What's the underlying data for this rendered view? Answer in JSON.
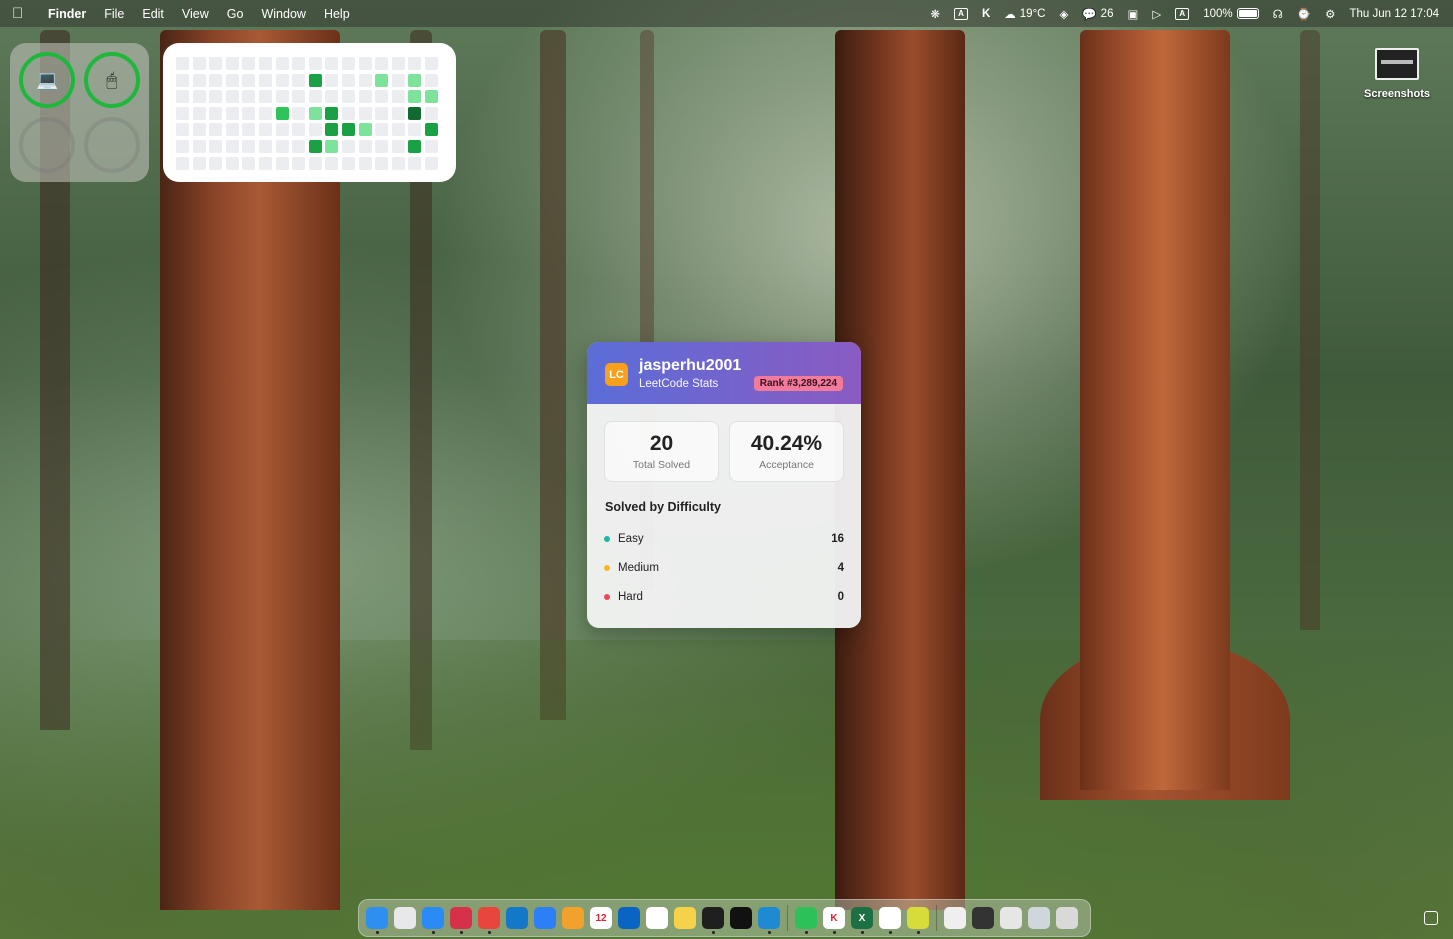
{
  "menubar": {
    "apple_icon": "apple-icon",
    "app_name": "Finder",
    "menus": [
      "File",
      "Edit",
      "View",
      "Go",
      "Window",
      "Help"
    ],
    "status": {
      "weather": "19°C",
      "wechat_count": "26",
      "input_source": "A",
      "battery": "100%",
      "datetime": "Thu Jun 12  17:04"
    }
  },
  "rings_widget": {
    "devices": [
      {
        "icon": "laptop-icon",
        "glyph": "💻",
        "active": true
      },
      {
        "icon": "mouse-icon",
        "glyph": "🖱",
        "active": true
      },
      {
        "icon": "empty-slot",
        "glyph": "",
        "active": false
      },
      {
        "icon": "empty-slot",
        "glyph": "",
        "active": false
      }
    ]
  },
  "heatmap": {
    "columns": 16,
    "rows": 7,
    "levels": [
      [
        0,
        0,
        0,
        0,
        0,
        0,
        0,
        0,
        0,
        0,
        0,
        0,
        0,
        0,
        0,
        0
      ],
      [
        0,
        0,
        0,
        0,
        0,
        0,
        0,
        0,
        3,
        0,
        0,
        0,
        1,
        0,
        1,
        0
      ],
      [
        0,
        0,
        0,
        0,
        0,
        0,
        0,
        0,
        0,
        0,
        0,
        0,
        0,
        0,
        1,
        1
      ],
      [
        0,
        0,
        0,
        0,
        0,
        0,
        2,
        0,
        1,
        3,
        0,
        0,
        0,
        0,
        4,
        0
      ],
      [
        0,
        0,
        0,
        0,
        0,
        0,
        0,
        0,
        0,
        3,
        3,
        1,
        0,
        0,
        0,
        3
      ],
      [
        0,
        0,
        0,
        0,
        0,
        0,
        0,
        0,
        3,
        1,
        0,
        0,
        0,
        0,
        3,
        0
      ],
      [
        0,
        0,
        0,
        0,
        0,
        0,
        0,
        0,
        0,
        0,
        0,
        0,
        0,
        0,
        0,
        0
      ]
    ]
  },
  "desktop": {
    "folder_label": "Screenshots"
  },
  "leetcode": {
    "logo": "LC",
    "username": "jasperhu2001",
    "subtitle": "LeetCode Stats",
    "rank": "Rank #3,289,224",
    "total_solved": "20",
    "total_solved_label": "Total Solved",
    "acceptance": "40.24%",
    "acceptance_label": "Acceptance",
    "section_title": "Solved by Difficulty",
    "difficulties": [
      {
        "label": "Easy",
        "count": "16",
        "color": "#1cb8a6"
      },
      {
        "label": "Medium",
        "count": "4",
        "color": "#f5b72a"
      },
      {
        "label": "Hard",
        "count": "0",
        "color": "#ee4857"
      }
    ]
  },
  "dock": {
    "apps": [
      {
        "name": "finder-icon",
        "color": "#2f8ff0",
        "running": true,
        "glyph": ""
      },
      {
        "name": "launchpad-icon",
        "color": "#e8e8ea",
        "running": false,
        "glyph": ""
      },
      {
        "name": "safari-icon",
        "color": "#2a8af6",
        "running": true,
        "glyph": ""
      },
      {
        "name": "creative-app-icon",
        "color": "#d6304a",
        "running": true,
        "glyph": ""
      },
      {
        "name": "chrome-icon",
        "color": "#e8453c",
        "running": true,
        "glyph": ""
      },
      {
        "name": "edge-icon",
        "color": "#1478c8",
        "running": false,
        "glyph": ""
      },
      {
        "name": "app-store-icon",
        "color": "#2d7ff6",
        "running": false,
        "glyph": ""
      },
      {
        "name": "photos-icon",
        "color": "#f2a12d",
        "running": false,
        "glyph": ""
      },
      {
        "name": "calendar-icon",
        "color": "#ffffff",
        "running": false,
        "glyph": "12"
      },
      {
        "name": "outlook-icon",
        "color": "#0a64c4",
        "running": false,
        "glyph": ""
      },
      {
        "name": "reminders-icon",
        "color": "#ffffff",
        "running": false,
        "glyph": ""
      },
      {
        "name": "notes-icon",
        "color": "#f6d24a",
        "running": false,
        "glyph": ""
      },
      {
        "name": "terminal-icon",
        "color": "#1f1f1f",
        "running": true,
        "glyph": ""
      },
      {
        "name": "cursor-icon",
        "color": "#111111",
        "running": false,
        "glyph": ""
      },
      {
        "name": "vscode-icon",
        "color": "#1f8ad2",
        "running": true,
        "glyph": ""
      },
      {
        "name": "wechat-icon",
        "color": "#2dc15a",
        "running": true,
        "glyph": ""
      },
      {
        "name": "k-app-icon",
        "color": "#ffffff",
        "running": true,
        "glyph": "K"
      },
      {
        "name": "excel-icon",
        "color": "#1d7044",
        "running": true,
        "glyph": "X"
      },
      {
        "name": "chatgpt-icon",
        "color": "#ffffff",
        "running": true,
        "glyph": ""
      },
      {
        "name": "pear-app-icon",
        "color": "#d8dc3a",
        "running": true,
        "glyph": ""
      },
      {
        "name": "document-icon",
        "color": "#efefef",
        "running": false,
        "glyph": ""
      },
      {
        "name": "window-thumbnail-icon",
        "color": "#333333",
        "running": false,
        "glyph": ""
      },
      {
        "name": "spreadsheet-thumbnail-icon",
        "color": "#e6e6e6",
        "running": false,
        "glyph": ""
      },
      {
        "name": "image-thumbnail-icon",
        "color": "#cfd6dc",
        "running": false,
        "glyph": ""
      },
      {
        "name": "trash-icon",
        "color": "#d9d9d9",
        "running": false,
        "glyph": ""
      }
    ]
  }
}
